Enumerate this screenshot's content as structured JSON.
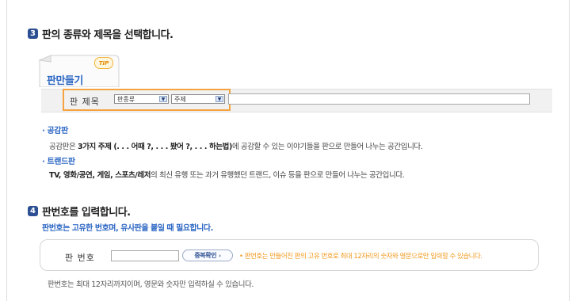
{
  "step3": {
    "num": "3",
    "title": "판의 종류와 제목을 선택합니다."
  },
  "tab": {
    "label": "판만들기",
    "tip": "TIP"
  },
  "title_row": {
    "label": "판 제목",
    "category_select": "판종류",
    "subject_select": "주제",
    "title_value": ""
  },
  "descriptions": [
    {
      "bullet": "·",
      "heading": "공감판",
      "text_pre": "공감판은 ",
      "text_bold": "3가지 주제 (. . . 어때 ?, . . . 봤어 ?, . . . 하는법)",
      "text_post": "에 공감할 수 있는 이야기들을 판으로 만들어 나누는 공간입니다."
    },
    {
      "bullet": "·",
      "heading": "트랜드판",
      "text_pre": "",
      "text_bold": "TV, 영화/공연, 게임, 스포츠/레저",
      "text_post": "의 최신 유행 또는 과거 유행했던 트랜드, 이슈 등을 판으로 만들어 나누는 공간입니다."
    }
  ],
  "step4": {
    "num": "4",
    "title": "판번호를 입력합니다.",
    "subtitle": "판번호는 고유한 번호며, 유사판을 붙일 때 필요합니다."
  },
  "number_row": {
    "label": "판 번호",
    "value": "",
    "check_button": "중복확인",
    "note": "판번호는 만들어진 판의 고유 번호로 최대 12자리의 숫자와 영문으로만 입력할 수 있습니다."
  },
  "footnote": "판번호는 최대 12자리까지이며, 영문와 숫자만 입력하실 수 있습니다.",
  "colors": {
    "accent_blue": "#2c67c4",
    "badge_navy": "#2c4f93",
    "highlight_orange": "#f4a340"
  }
}
